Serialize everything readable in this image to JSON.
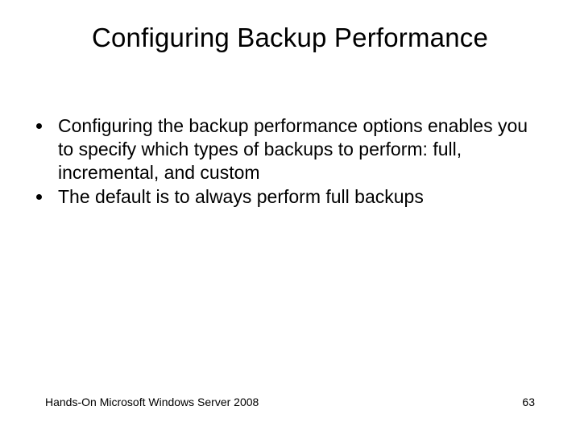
{
  "slide": {
    "title": "Configuring Backup Performance",
    "bullets": [
      "Configuring the backup performance options enables you to specify which types of backups to perform: full, incremental, and custom",
      "The default is to always perform full backups"
    ],
    "footer_text": "Hands-On Microsoft Windows Server 2008",
    "page_number": "63"
  }
}
